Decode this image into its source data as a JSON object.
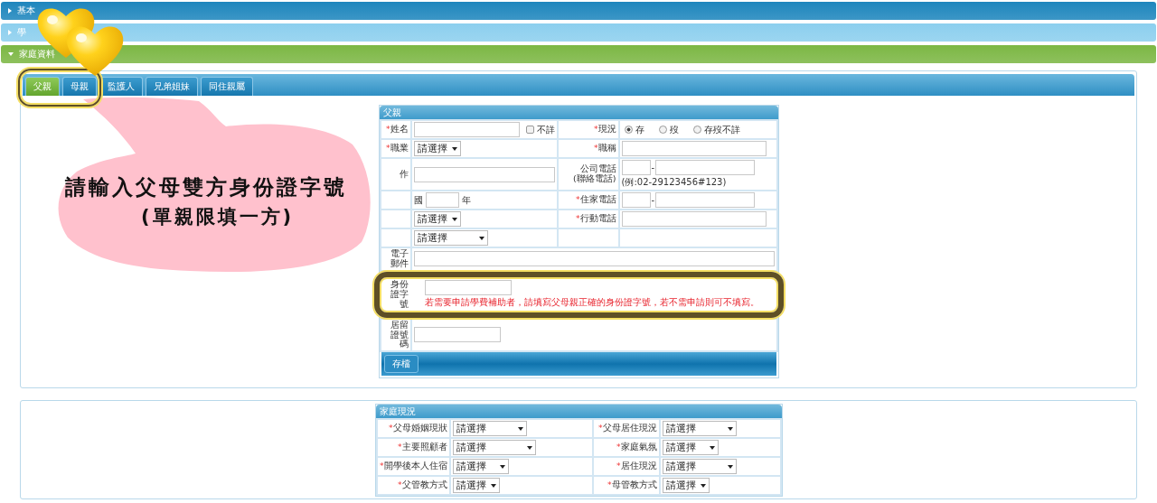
{
  "sections": [
    {
      "title": "基本",
      "color": "#1e86bd",
      "expanded": false
    },
    {
      "title": "學",
      "color": "#8ccfee",
      "expanded": false
    },
    {
      "title": "家庭資料",
      "color": "#7cb744",
      "expanded": true
    }
  ],
  "tabs": [
    {
      "label": "父親",
      "selected": true
    },
    {
      "label": "母親",
      "selected": false
    },
    {
      "label": "監護人",
      "selected": false
    },
    {
      "label": "兄弟姐妹",
      "selected": false
    },
    {
      "label": "同住親屬",
      "selected": false
    }
  ],
  "father_form": {
    "title": "父親",
    "save_button": "存檔",
    "rows": [
      {
        "kind": "pair",
        "left": {
          "mark": "*",
          "label": "姓名",
          "fields": [
            {
              "kind": "input-m"
            },
            {
              "kind": "checkbox",
              "label": "不詳",
              "checked": false
            }
          ]
        },
        "right": {
          "mark": "*",
          "label": "現況",
          "fields": [
            {
              "kind": "radio",
              "label": "存",
              "selected": true
            },
            {
              "kind": "radio",
              "label": "歿",
              "selected": false
            },
            {
              "kind": "radio",
              "label": "存歿不詳",
              "selected": false
            }
          ]
        }
      },
      {
        "kind": "pair",
        "left": {
          "mark": "*",
          "label": "職業",
          "fields": [
            {
              "kind": "select-xs",
              "value": "請選擇"
            }
          ]
        },
        "right": {
          "mark": "*",
          "label": "職稱",
          "fields": [
            {
              "kind": "input-l"
            }
          ]
        }
      },
      {
        "kind": "pair",
        "left": {
          "label": "作",
          "fields": [
            {
              "kind": "input-l"
            }
          ]
        },
        "right": {
          "label": "公司電話",
          "sublabel": "(聯絡電話)",
          "fields": [
            {
              "kind": "phone",
              "separator": "-",
              "hint": "(例:02-29123456#123)"
            }
          ]
        }
      },
      {
        "kind": "pair",
        "left": {
          "fields": [
            {
              "kind": "text",
              "text": "國"
            },
            {
              "kind": "input-xs"
            },
            {
              "kind": "text",
              "text": "年"
            }
          ]
        },
        "right": {
          "mark": "*",
          "label": "住家電話",
          "fields": [
            {
              "kind": "phone",
              "separator": "-"
            }
          ]
        }
      },
      {
        "kind": "pair",
        "left": {
          "fields": [
            {
              "kind": "select-xs",
              "value": "請選擇"
            }
          ]
        },
        "right": {
          "mark": "*",
          "label": "行動電話",
          "fields": [
            {
              "kind": "input-l"
            }
          ]
        }
      },
      {
        "kind": "pair",
        "left": {
          "fields": [
            {
              "kind": "select-m",
              "value": "請選擇"
            }
          ]
        },
        "right": {}
      },
      {
        "kind": "full",
        "label": "電子郵件",
        "fields": [
          {
            "kind": "input-full"
          }
        ]
      },
      {
        "kind": "full",
        "label": "身份證字號",
        "highlighted": true,
        "fields": [
          {
            "kind": "input-s"
          },
          {
            "kind": "note",
            "text": "若需要申請學費補助者，請填寫父母親正確的身份證字號，若不需申請則可不填寫。"
          }
        ]
      },
      {
        "kind": "full",
        "label": "居留證號碼",
        "highlighted": false,
        "fields": [
          {
            "kind": "input-s"
          }
        ]
      }
    ]
  },
  "family_status": {
    "title": "家庭現況",
    "rows": [
      {
        "kind": "pair",
        "left": {
          "mark": "*",
          "label": "父母婚姻現狀",
          "fields": [
            {
              "kind": "select-m",
              "value": "請選擇"
            }
          ]
        },
        "right": {
          "mark": "*",
          "label": "父母居住現況",
          "fields": [
            {
              "kind": "select-m",
              "value": "請選擇"
            }
          ]
        }
      },
      {
        "kind": "pair",
        "left": {
          "mark": "*",
          "label": "主要照顧者",
          "fields": [
            {
              "kind": "select-l",
              "value": "請選擇"
            }
          ]
        },
        "right": {
          "mark": "*",
          "label": "家庭氣氛",
          "fields": [
            {
              "kind": "select-s",
              "value": "請選擇"
            }
          ]
        }
      },
      {
        "kind": "pair",
        "left": {
          "mark": "*",
          "label": "開學後本人住宿",
          "fields": [
            {
              "kind": "select-s",
              "value": "請選擇"
            }
          ]
        },
        "right": {
          "mark": "*",
          "label": "居住現況",
          "fields": [
            {
              "kind": "select-m",
              "value": "請選擇"
            }
          ]
        }
      },
      {
        "kind": "pair",
        "left": {
          "mark": "*",
          "label": "父管教方式",
          "fields": [
            {
              "kind": "select-xs",
              "value": "請選擇"
            }
          ]
        },
        "right": {
          "mark": "*",
          "label": "母管教方式",
          "fields": [
            {
              "kind": "select-xs",
              "value": "請選擇"
            }
          ]
        }
      }
    ]
  },
  "callout": {
    "lines": [
      "請輸入父母雙方身份證字號",
      "(單親限填一方)"
    ]
  }
}
